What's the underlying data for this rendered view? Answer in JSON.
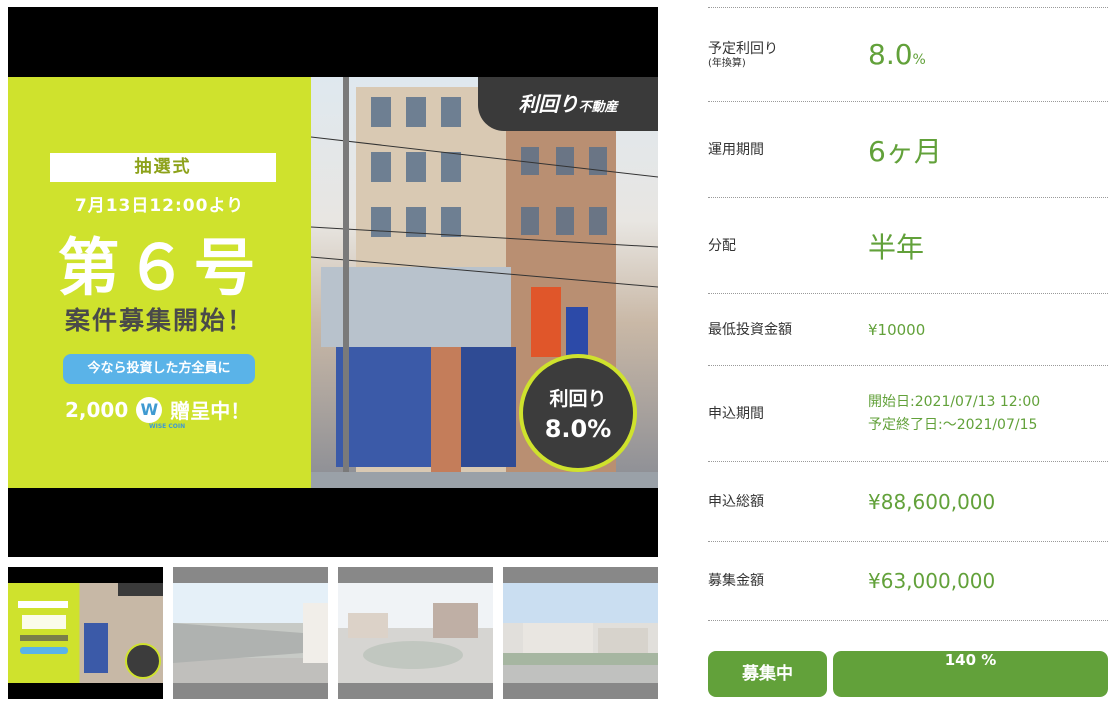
{
  "gallery": {
    "banner": {
      "tag": "抽選式",
      "date_line": "7月13日12:00より",
      "issue": "第６号",
      "recruit": "案件募集開始！",
      "pill": "今なら投資した方全員に",
      "coin_amount": "2,000",
      "coin_symbol": "W",
      "coin_name": "WISE COIN",
      "coin_suffix": "贈呈中！"
    },
    "brand_badge_main": "利回り",
    "brand_badge_sub": "不動産",
    "yield_label": "利回り",
    "yield_value": "8.0%",
    "thumbnails": [
      "thumb-campaign",
      "thumb-station",
      "thumb-roundabout",
      "thumb-cityscape"
    ],
    "selected_thumbnail": 0
  },
  "details": {
    "expected_yield": {
      "label": "予定利回り",
      "sublabel": "(年換算)",
      "value": "8.0",
      "unit": "%"
    },
    "period": {
      "label": "運用期間",
      "value": "6ヶ月"
    },
    "distribution": {
      "label": "分配",
      "value": "半年"
    },
    "min_investment": {
      "label": "最低投資金額",
      "value": "¥10000"
    },
    "application_period": {
      "label": "申込期間",
      "start": "開始日:2021/07/13 12:00",
      "end": "予定終了日:～2021/07/15"
    },
    "total_applied": {
      "label": "申込総額",
      "value": "¥88,600,000"
    },
    "target_amount": {
      "label": "募集金額",
      "value": "¥63,000,000"
    }
  },
  "status": {
    "badge": "募集中",
    "progress_text": "140 %",
    "progress_fraction": 1.0
  },
  "colors": {
    "accent_green": "#62a13a",
    "banner_lime": "#cfe22d"
  }
}
